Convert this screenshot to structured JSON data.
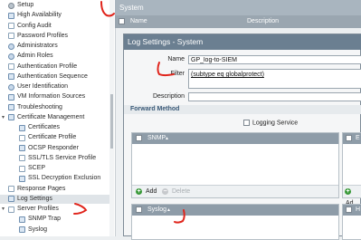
{
  "nav": {
    "items": [
      {
        "label": "Setup",
        "icon": "gear-icon",
        "depth": 0,
        "twisty": "",
        "selected": false
      },
      {
        "label": "High Availability",
        "icon": "network-icon",
        "depth": 0,
        "twisty": "",
        "selected": false
      },
      {
        "label": "Config Audit",
        "icon": "audit-icon",
        "depth": 0,
        "twisty": "",
        "selected": false
      },
      {
        "label": "Password Profiles",
        "icon": "password-icon",
        "depth": 0,
        "twisty": "",
        "selected": false
      },
      {
        "label": "Administrators",
        "icon": "user-icon",
        "depth": 0,
        "twisty": "",
        "selected": false
      },
      {
        "label": "Admin Roles",
        "icon": "roles-icon",
        "depth": 0,
        "twisty": "",
        "selected": false
      },
      {
        "label": "Authentication Profile",
        "icon": "auth-profile-icon",
        "depth": 0,
        "twisty": "",
        "selected": false
      },
      {
        "label": "Authentication Sequence",
        "icon": "auth-sequence-icon",
        "depth": 0,
        "twisty": "",
        "selected": false
      },
      {
        "label": "User Identification",
        "icon": "user-id-icon",
        "depth": 0,
        "twisty": "",
        "selected": false
      },
      {
        "label": "VM Information Sources",
        "icon": "vm-icon",
        "depth": 0,
        "twisty": "",
        "selected": false
      },
      {
        "label": "Troubleshooting",
        "icon": "troubleshoot-icon",
        "depth": 0,
        "twisty": "",
        "selected": false
      },
      {
        "label": "Certificate Management",
        "icon": "certificate-folder-icon",
        "depth": 0,
        "twisty": "▾",
        "selected": false
      },
      {
        "label": "Certificates",
        "icon": "certificate-icon",
        "depth": 1,
        "twisty": "",
        "selected": false
      },
      {
        "label": "Certificate Profile",
        "icon": "certificate-profile-icon",
        "depth": 1,
        "twisty": "",
        "selected": false
      },
      {
        "label": "OCSP Responder",
        "icon": "ocsp-icon",
        "depth": 1,
        "twisty": "",
        "selected": false
      },
      {
        "label": "SSL/TLS Service Profile",
        "icon": "ssl-icon",
        "depth": 1,
        "twisty": "",
        "selected": false
      },
      {
        "label": "SCEP",
        "icon": "scep-icon",
        "depth": 1,
        "twisty": "",
        "selected": false
      },
      {
        "label": "SSL Decryption Exclusion",
        "icon": "ssl-exclusion-icon",
        "depth": 1,
        "twisty": "",
        "selected": false
      },
      {
        "label": "Response Pages",
        "icon": "response-pages-icon",
        "depth": 0,
        "twisty": "",
        "selected": false
      },
      {
        "label": "Log Settings",
        "icon": "log-settings-icon",
        "depth": 0,
        "twisty": "",
        "selected": true
      },
      {
        "label": "Server Profiles",
        "icon": "server-profiles-icon",
        "depth": 0,
        "twisty": "▾",
        "selected": false
      },
      {
        "label": "SNMP Trap",
        "icon": "snmp-trap-icon",
        "depth": 1,
        "twisty": "",
        "selected": false
      },
      {
        "label": "Syslog",
        "icon": "syslog-icon",
        "depth": 1,
        "twisty": "",
        "selected": false
      }
    ]
  },
  "background": {
    "header": "System",
    "col_name": "Name",
    "col_description": "Description"
  },
  "dialog": {
    "title": "Log Settings - System",
    "name_label": "Name",
    "name_value": "GP_log-to-SIEM",
    "filter_label": "Filter",
    "filter_value": "(subtype eq globalprotect)",
    "description_label": "Description",
    "description_value": "",
    "section_title": "Forward Method",
    "logging_service_label": "Logging Service",
    "snmp_header": "SNMP",
    "email_header": "E",
    "syslog_header": "Syslog",
    "http_header": "H",
    "add_label": "Add",
    "delete_label": "Delete",
    "add_label_right": "Ad"
  },
  "colors": {
    "annotation": "#e0241b",
    "accent": "#3b5a78",
    "title_bar": "#6b7f91"
  }
}
